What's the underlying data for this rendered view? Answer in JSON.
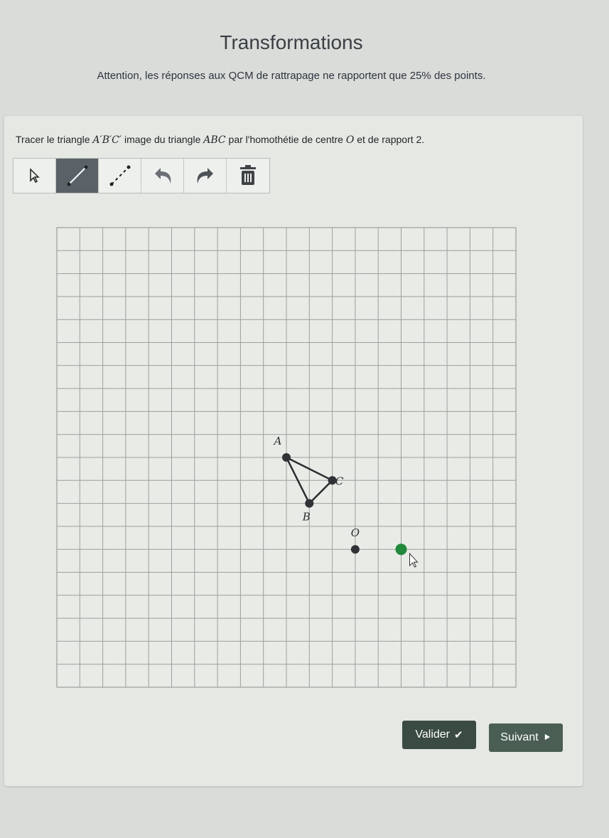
{
  "page": {
    "title": "Transformations",
    "notice": "Attention, les réponses aux QCM de rattrapage ne rapportent que 25% des points."
  },
  "question": {
    "prefix": "Tracer le triangle ",
    "image_triangle": "A′B′C′",
    "middle": " image du triangle ",
    "source_triangle": "ABC",
    "middle2": " par l'homothétie de centre ",
    "center": "O",
    "suffix": " et de rapport 2."
  },
  "toolbar": {
    "tools": [
      {
        "name": "select-tool",
        "icon": "pointer-icon",
        "active": false
      },
      {
        "name": "segment-tool",
        "icon": "segment-icon",
        "active": true
      },
      {
        "name": "dashed-segment-tool",
        "icon": "dashed-segment-icon",
        "active": false
      },
      {
        "name": "undo-tool",
        "icon": "undo-icon",
        "active": false
      },
      {
        "name": "redo-tool",
        "icon": "redo-icon",
        "active": false
      },
      {
        "name": "delete-tool",
        "icon": "trash-icon",
        "active": false
      }
    ]
  },
  "graph": {
    "grid_cols": 20,
    "grid_rows": 20,
    "points": [
      {
        "label": "A",
        "x": 10,
        "y": 10
      },
      {
        "label": "C",
        "x": 12,
        "y": 11
      },
      {
        "label": "B",
        "x": 11,
        "y": 12
      },
      {
        "label": "O",
        "x": 13,
        "y": 14
      }
    ],
    "triangle": [
      "A",
      "C",
      "B"
    ],
    "active_point": {
      "x": 15,
      "y": 14
    },
    "accent_color": "#1f8a3a",
    "point_color": "#2f3337",
    "grid_color": "#9aa09c"
  },
  "buttons": {
    "validate": "Valider",
    "validate_glyph": "✔",
    "next": "Suivant",
    "next_glyph": "⯈"
  }
}
